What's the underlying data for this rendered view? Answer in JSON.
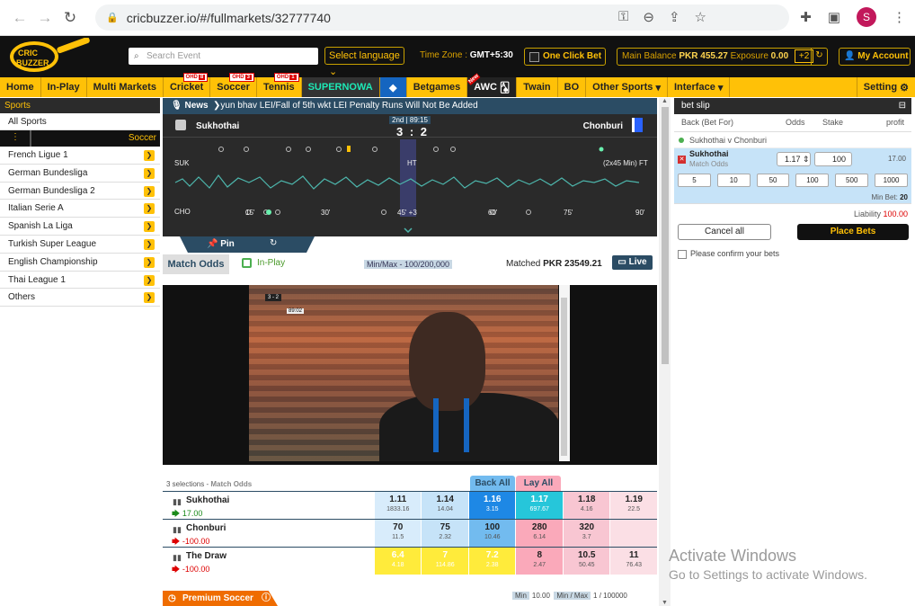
{
  "browser": {
    "url": "cricbuzzer.io/#/fullmarkets/32777740",
    "avatar_letter": "S"
  },
  "header": {
    "logo_text": "CRIC BUZZER",
    "search_placeholder": "Search Event",
    "language": "Select language",
    "timezone_label": "Time Zone :",
    "timezone_value": "GMT+5:30",
    "one_click_bet": "One Click Bet",
    "main_balance_label": "Main Balance",
    "main_balance_value": "PKR 455.27",
    "exposure_label": "Exposure",
    "exposure_value": "0.00",
    "plus_badge": "+2",
    "my_account": "My Account"
  },
  "menu": {
    "items": [
      "Home",
      "In-Play",
      "Multi Markets"
    ],
    "cricket": {
      "label": "Cricket",
      "badge_text": "OHD",
      "count": "8"
    },
    "soccer": {
      "label": "Soccer",
      "badge_text": "OHD",
      "count": "3"
    },
    "tennis": {
      "label": "Tennis",
      "badge_text": "OHD",
      "count": "1"
    },
    "supernowa": "SUPERNOWA",
    "betgames": "Betgames",
    "awc": "AWC",
    "awc_new": "New",
    "twain": "Twain",
    "bo": "BO",
    "other_sports": "Other Sports",
    "interface": "Interface",
    "setting": "Setting"
  },
  "sidebar": {
    "title": "Sports",
    "all_sports": "All Sports",
    "soccer_label": "Soccer",
    "leagues": [
      "French Ligue 1",
      "German Bundesliga",
      "German Bundesliga 2",
      "Italian Serie A",
      "Spanish La Liga",
      "Turkish Super League",
      "English Championship",
      "Thai League 1",
      "Others"
    ]
  },
  "news": {
    "label": "News",
    "text": "yun bhav LEI/Fall of 5th wkt LEI Penalty Runs Will Not Be Added"
  },
  "scoreboard": {
    "home": "Sukhothai",
    "away": "Chonburi",
    "period": "2nd | 89:15",
    "score": "3 : 2",
    "home_abbr": "SUK",
    "away_abbr": "CHO",
    "ht": "HT",
    "ft": "(2x45 Min) FT",
    "ticks": [
      "15'",
      "30'",
      "45' +3",
      "60'",
      "75'",
      "90'"
    ]
  },
  "pin": {
    "label": "Pin"
  },
  "match_odds_bar": {
    "tab": "Match Odds",
    "inplay": "In-Play",
    "minmax": "Min/Max - 100/200,000",
    "matched_label": "Matched",
    "matched_value": "PKR 23549.21",
    "live": "Live"
  },
  "video": {
    "osd_score": "3 - 2",
    "osd_time": "89:02"
  },
  "market": {
    "selections": "3 selections -",
    "selections_market": "Match Odds",
    "back_all": "Back All",
    "lay_all": "Lay All",
    "rows": [
      {
        "team": "Sukhothai",
        "pl": "17.00",
        "odds": [
          [
            "1.11",
            "1833.16"
          ],
          [
            "1.14",
            "14.04"
          ],
          [
            "1.16",
            "3.15"
          ],
          [
            "1.17",
            "697.67"
          ],
          [
            "1.18",
            "4.16"
          ],
          [
            "1.19",
            "22.5"
          ]
        ]
      },
      {
        "team": "Chonburi",
        "pl": "-100.00",
        "odds": [
          [
            "70",
            "11.5"
          ],
          [
            "75",
            "2.32"
          ],
          [
            "100",
            "10.46"
          ],
          [
            "280",
            "6.14"
          ],
          [
            "320",
            "3.7"
          ],
          [
            "",
            ""
          ]
        ]
      },
      {
        "team": "The Draw",
        "pl": "-100.00",
        "odds": [
          [
            "6.4",
            "4.18"
          ],
          [
            "7",
            "114.86"
          ],
          [
            "7.2",
            "2.38"
          ],
          [
            "8",
            "2.47"
          ],
          [
            "10.5",
            "50.45"
          ],
          [
            "11",
            "76.43"
          ]
        ]
      }
    ],
    "premium": "Premium Soccer",
    "footer_min_label": "Min",
    "footer_min": "10.00",
    "footer_max_label": "Min / Max",
    "footer_max": "1 / 100000"
  },
  "betslip": {
    "title": "bet slip",
    "col_back": "Back (Bet For)",
    "col_odds": "Odds",
    "col_stake": "Stake",
    "col_profit": "profit",
    "match": "Sukhothai v Chonburi",
    "sel_team": "Sukhothai",
    "sel_market": "Match Odds",
    "sel_odds": "1.17",
    "sel_stake": "100",
    "sel_profit": "17.00",
    "stakes": [
      "5",
      "10",
      "50",
      "100",
      "500",
      "1000"
    ],
    "min_bet_label": "Min Bet:",
    "min_bet": "20",
    "liability_label": "Liability",
    "liability": "100.00",
    "cancel": "Cancel all",
    "place": "Place Bets",
    "confirm": "Please confirm your bets"
  },
  "watermark": {
    "line1": "Activate Windows",
    "line2": "Go to Settings to activate Windows."
  }
}
